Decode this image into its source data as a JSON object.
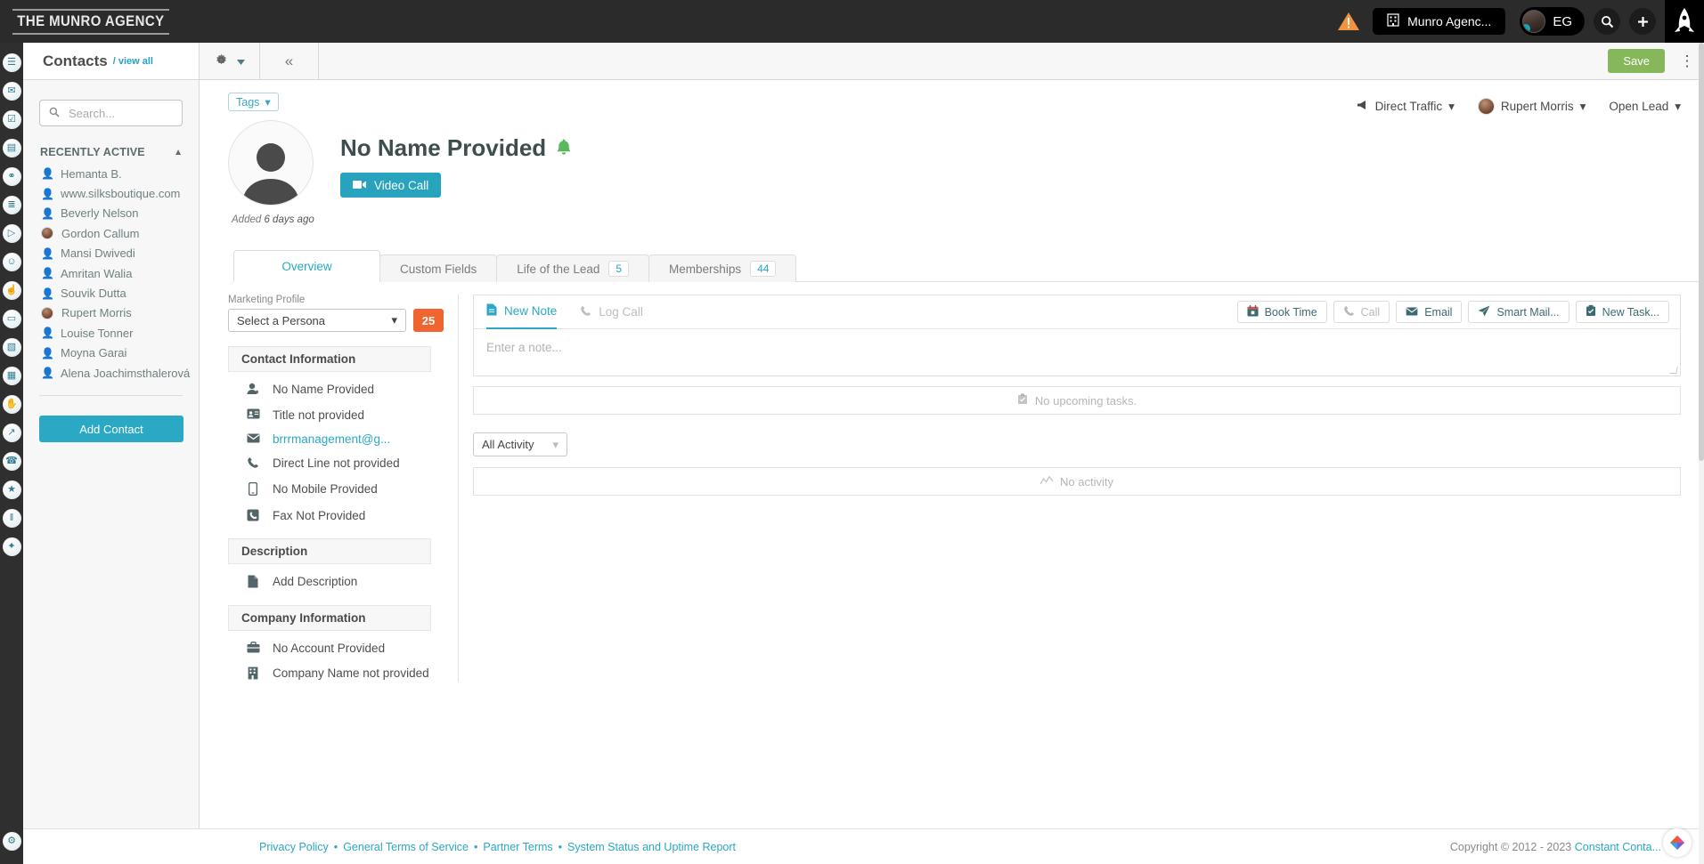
{
  "topbar": {
    "brand": "THE MUNRO AGENCY",
    "account_label": "Munro Agenc...",
    "user_initials": "EG",
    "warning_icon": "warning-triangle-icon",
    "building_icon": "building-icon",
    "search_icon": "search-icon",
    "add_icon": "plus-icon",
    "logo_icon": "rocket-logo-icon"
  },
  "rail": {
    "items": [
      {
        "name": "contacts",
        "glyph": "☰"
      },
      {
        "name": "email",
        "glyph": "✉"
      },
      {
        "name": "clipboard",
        "glyph": "☑"
      },
      {
        "name": "guides",
        "glyph": "▤"
      },
      {
        "name": "automation",
        "glyph": "⚭"
      },
      {
        "name": "lists",
        "glyph": "≣"
      },
      {
        "name": "campaigns",
        "glyph": "▷"
      },
      {
        "name": "chat",
        "glyph": "☺"
      },
      {
        "name": "social",
        "glyph": "☝"
      },
      {
        "name": "ads",
        "glyph": "▭"
      },
      {
        "name": "landing-pages",
        "glyph": "▧"
      },
      {
        "name": "calendar",
        "glyph": "▦"
      },
      {
        "name": "partners",
        "glyph": "✋"
      },
      {
        "name": "analytics",
        "glyph": "↗"
      },
      {
        "name": "support",
        "glyph": "☎"
      },
      {
        "name": "leads",
        "glyph": "★"
      },
      {
        "name": "reports",
        "glyph": "‖"
      },
      {
        "name": "security",
        "glyph": "✦"
      }
    ],
    "bottom": {
      "name": "settings",
      "glyph": "⚙"
    }
  },
  "pagehead": {
    "title": "Contacts",
    "view_all": "/ view all",
    "gear_icon": "gear-icon",
    "caret_icon": "chevron-down-icon",
    "collapse_icon": "collapse-left-icon",
    "save_label": "Save",
    "kebab_icon": "kebab-menu-icon"
  },
  "sidebar": {
    "search_placeholder": "Search...",
    "search_value": "",
    "section_title": "RECENTLY ACTIVE",
    "collapse_caret": "▲",
    "contacts": [
      {
        "name": "Hemanta B.",
        "avatar": "glyph"
      },
      {
        "name": "www.silksboutique.com",
        "avatar": "glyph"
      },
      {
        "name": "Beverly Nelson",
        "avatar": "glyph"
      },
      {
        "name": "Gordon Callum",
        "avatar": "photo"
      },
      {
        "name": "Mansi Dwivedi",
        "avatar": "glyph"
      },
      {
        "name": "Amritan Walia",
        "avatar": "glyph"
      },
      {
        "name": "Souvik Dutta",
        "avatar": "glyph"
      },
      {
        "name": "Rupert Morris",
        "avatar": "photo"
      },
      {
        "name": "Louise Tonner",
        "avatar": "glyph"
      },
      {
        "name": "Moyna Garai",
        "avatar": "glyph"
      },
      {
        "name": "Alena Joachimsthalerová",
        "avatar": "glyph"
      }
    ],
    "add_contact_label": "Add Contact"
  },
  "contact": {
    "tags_label": "Tags",
    "name": "No Name Provided",
    "bell_icon": "green-bell-icon",
    "video_call_label": "Video Call",
    "added_prefix": "Added",
    "added_value": "6 days ago",
    "source": "Direct Traffic",
    "owner": "Rupert Morris",
    "status": "Open Lead"
  },
  "tabs": [
    {
      "label": "Overview",
      "count": "",
      "active": true
    },
    {
      "label": "Custom Fields",
      "count": "",
      "active": false
    },
    {
      "label": "Life of the Lead",
      "count": "5",
      "active": false
    },
    {
      "label": "Memberships",
      "count": "44",
      "active": false
    }
  ],
  "overview": {
    "marketing_profile_label": "Marketing Profile",
    "persona_value": "Select a Persona",
    "score_badge": "25",
    "sections": [
      {
        "title": "Contact Information",
        "rows": [
          {
            "icon": "person-add-icon",
            "text": "No Name Provided",
            "link": false
          },
          {
            "icon": "id-card-icon",
            "text": "Title not provided",
            "link": false
          },
          {
            "icon": "envelope-icon",
            "text": "brrrmanagement@g...",
            "link": true
          },
          {
            "icon": "phone-icon",
            "text": "Direct Line not provided",
            "link": false
          },
          {
            "icon": "mobile-icon",
            "text": "No Mobile Provided",
            "link": false
          },
          {
            "icon": "fax-icon",
            "text": "Fax Not Provided",
            "link": false
          }
        ]
      },
      {
        "title": "Description",
        "rows": [
          {
            "icon": "document-icon",
            "text": "Add Description",
            "link": false
          }
        ]
      },
      {
        "title": "Company Information",
        "rows": [
          {
            "icon": "briefcase-icon",
            "text": "No Account Provided",
            "link": false
          },
          {
            "icon": "building-icon",
            "text": "Company Name not provided",
            "link": false
          }
        ]
      }
    ]
  },
  "activity": {
    "note_tabs": [
      {
        "label": "New Note",
        "icon": "note-icon",
        "active": true
      },
      {
        "label": "Log Call",
        "icon": "phone-icon",
        "active": false
      }
    ],
    "actions": [
      {
        "label": "Book Time",
        "icon": "calendar-icon",
        "disabled": false
      },
      {
        "label": "Call",
        "icon": "phone-icon",
        "disabled": true
      },
      {
        "label": "Email",
        "icon": "envelope-icon",
        "disabled": false
      },
      {
        "label": "Smart Mail...",
        "icon": "paper-plane-icon",
        "disabled": false
      },
      {
        "label": "New Task...",
        "icon": "clipboard-check-icon",
        "disabled": false
      }
    ],
    "note_placeholder": "Enter a note...",
    "no_tasks_text": "No upcoming tasks.",
    "no_tasks_icon": "clipboard-check-icon",
    "filter_value": "All Activity",
    "no_activity_text": "No activity",
    "no_activity_icon": "activity-icon"
  },
  "footer": {
    "links": [
      {
        "label": "Privacy Policy"
      },
      {
        "label": "General Terms of Service"
      },
      {
        "label": "Partner Terms"
      },
      {
        "label": "System Status and Uptime Report"
      }
    ],
    "separator": "•",
    "copyright": "Copyright © 2012 - 2023",
    "company": "Constant Conta...",
    "badge_icon": "constant-contact-logo-icon"
  },
  "colors": {
    "accent": "#2aa8c4",
    "save_green": "#86b85b",
    "badge_orange": "#f0652f",
    "dark_header": "#2b2b2b"
  }
}
